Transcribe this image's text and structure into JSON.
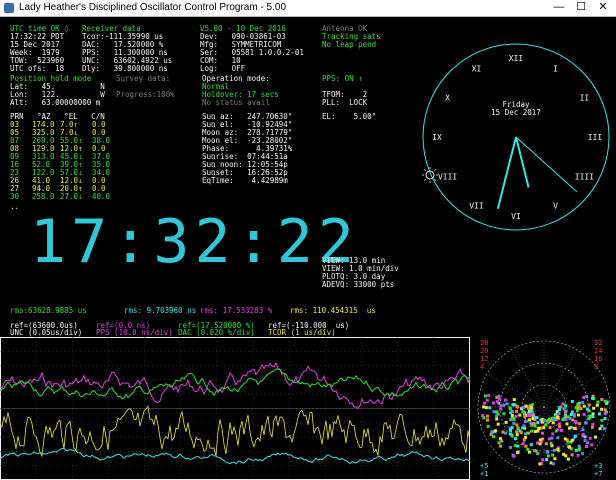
{
  "window": {
    "title": "Lady Heather's Disciplined Oscillator Control Program - 5.00",
    "minimize": "—",
    "maximize": "☐",
    "close": "✕"
  },
  "status": {
    "utc_ok": "UTC time OK ◊",
    "time": "17:32:22 PDT",
    "date": "15 Dec 2017",
    "week": "Week:  1979",
    "tow": "TOW:  523960",
    "utc_ofs": "UTC ofs:  18",
    "receiver": "Receiver data",
    "tcor": "Tcor:-111.35990 us",
    "dac": "DAC:   17.520000 %",
    "pps": "PPS:   11.300000 ns",
    "unc": "UNC:   63602.4922 us",
    "dly": "Dly:   39.800000 ns",
    "version": "V5.00 - 10 Dec 2016",
    "dev": "Dev:   090-03861-03",
    "mfg": "Mfg:   SYMMETRICOM",
    "ser": "Ser:   05581 1.0.0.2-01",
    "com": "COM:   10",
    "log": "Log:   OFF",
    "antenna": "Antenna OK",
    "tracking": "Tracking sats",
    "no_leap": "No leap pend"
  },
  "position": {
    "title": "Position hold mode",
    "lat": "Lat:   45.          N",
    "lon": "Lon:   122.         W",
    "alt": "Alt:   63.00000000 m"
  },
  "survey": {
    "label": "Survey data:",
    "progress": "Progress:100%"
  },
  "operation": {
    "label": "Operation mode:",
    "mode": "Normal",
    "holdover": "Holdover: 17 secs",
    "status": "No status avail"
  },
  "pps_block": {
    "pps_on": "PPS: ON ↑",
    "tfom": "TFOM:    2",
    "pll": "PLL:  LOCK",
    "el": "EL:    5.00°"
  },
  "sat_table": {
    "headers": "PRN   °AZ   °EL   C/N",
    "rows": [
      {
        "prn": "03",
        "az": "174.0",
        "el": "7.0↑",
        "cn": "0.0"
      },
      {
        "prn": "05",
        "az": "325.0",
        "el": "7.0↓",
        "cn": "0.0"
      },
      {
        "prn": "07",
        "az": "269.0",
        "el": "55.0↑",
        "cn": "38.0"
      },
      {
        "prn": "08",
        "az": "129.0",
        "el": "12.0↑",
        "cn": "0.0"
      },
      {
        "prn": "09",
        "az": "313.0",
        "el": "45.0↓",
        "cn": "37.0"
      },
      {
        "prn": "16",
        "az": "52.0",
        "el": "39.0↑",
        "cn": "35.0"
      },
      {
        "prn": "23",
        "az": "122.0",
        "el": "57.0↓",
        "cn": "34.0"
      },
      {
        "prn": "26",
        "az": "41.0",
        "el": "12.0↓",
        "cn": "0.0"
      },
      {
        "prn": "27",
        "az": "94.0",
        "el": "20.0↑",
        "cn": "0.0"
      },
      {
        "prn": "30",
        "az": "258.0",
        "el": "27.0↓",
        "cn": "40.0"
      }
    ],
    "more": ".."
  },
  "astro": {
    "sun_az": "Sun az:   247.70630°",
    "sun_el": "Sun el:   -10.92494°",
    "moon_az": "Moon az:  278.71779°",
    "moon_el": "Moon el:  -23.28002°",
    "phase": "Phase:      4.39731%",
    "sunrise": "Sunrise:  07:44:51a",
    "sun_noon": "Sun noon: 12:05:54p",
    "sunset": "Sunset:   16:26:52p",
    "eqtime": "EqTime:    4.42989m"
  },
  "big_clock": "17:32:22",
  "plot_info": {
    "view": "VIEW: 13.0 min",
    "view_div": "VIEW: 1.0 min/div",
    "plotq": "PLOTQ: 3.0 day",
    "adevq": "ADEVQ: 33000 pts"
  },
  "rms": {
    "unc": "rms:63628.9885 us",
    "pps": "rms: 9.703960 ns",
    "dac": "rms: 17.533283 %",
    "tcor": "rms: 110.454315  us"
  },
  "refs": {
    "unc": "ref=(63600.0us)",
    "pps": "ref=(0.0 ns)",
    "dac": "ref=(17.520000 %)",
    "tcor": "ref=(-110.000  us)"
  },
  "scales": {
    "unc": "UNC (0.05us/div)",
    "pps": "PPS (10.0 ns/div)",
    "dac": "DAC (0.020 %/div)",
    "tcor": "TCOR (1 us/div)"
  },
  "analog_clock": {
    "day": "Friday",
    "date": "15 Dec 2017",
    "hours": 17,
    "minutes": 32,
    "seconds": 22,
    "numerals": [
      "XII",
      "I",
      "II",
      "III",
      "IIII",
      "V",
      "VI",
      "VII",
      "VIII",
      "IX",
      "X",
      "XI"
    ]
  },
  "sky": {
    "labels_left": [
      "28",
      "20",
      "12",
      "4"
    ],
    "labels_right": [
      "32",
      "24",
      "16",
      "8"
    ],
    "labels_bottom_left": [
      "+5",
      "+1"
    ],
    "labels_bottom_right": [
      "+3",
      "+7"
    ]
  },
  "colors": {
    "green": "#28e228",
    "cyan": "#2ee8e8",
    "yellow": "#eaea28",
    "magenta": "#e53be5",
    "white": "#f2f2f2",
    "grid": "#4a4a4a"
  }
}
